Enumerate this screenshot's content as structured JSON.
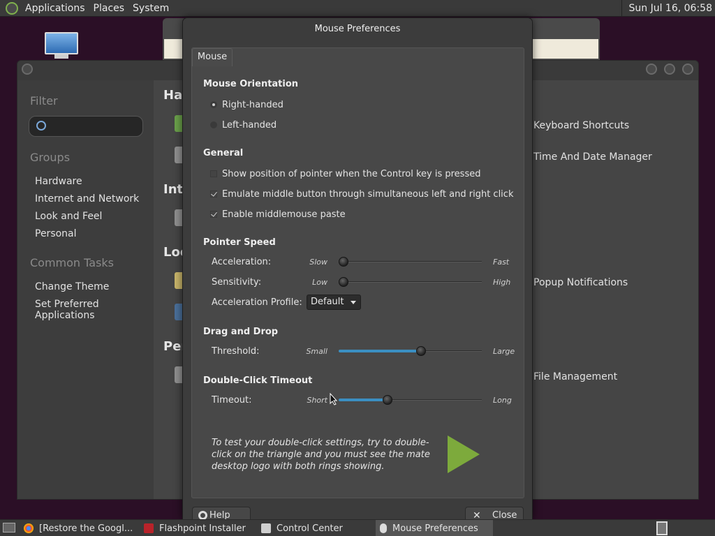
{
  "top_panel": {
    "menus": [
      "Applications",
      "Places",
      "System"
    ],
    "clock": "Sun Jul 16, 06:58"
  },
  "control_center": {
    "sidebar": {
      "filter_heading": "Filter",
      "groups_heading": "Groups",
      "groups": [
        "Hardware",
        "Internet and Network",
        "Look and Feel",
        "Personal"
      ],
      "tasks_heading": "Common Tasks",
      "tasks": [
        "Change Theme",
        "Set Preferred Applications"
      ]
    },
    "main": {
      "group_headings": [
        "Har",
        "Inte",
        "Loo",
        "Per"
      ],
      "items": [
        "Keyboard Shortcuts",
        "Time And Date Manager",
        "Popup Notifications",
        "File Management"
      ]
    }
  },
  "dialog": {
    "title": "Mouse Preferences",
    "tab": "Mouse",
    "orientation": {
      "heading": "Mouse Orientation",
      "options": [
        {
          "label": "Right-handed",
          "selected": true
        },
        {
          "label": "Left-handed",
          "selected": false
        }
      ]
    },
    "general": {
      "heading": "General",
      "options": [
        {
          "label": "Show position of pointer when the Control key is pressed",
          "checked": false
        },
        {
          "label": "Emulate middle button through simultaneous left and right click",
          "checked": true
        },
        {
          "label": "Enable middlemouse paste",
          "checked": true
        }
      ]
    },
    "pointer_speed": {
      "heading": "Pointer Speed",
      "acceleration": {
        "label": "Acceleration:",
        "min": "Slow",
        "max": "Fast",
        "value_fraction": 0.0
      },
      "sensitivity": {
        "label": "Sensitivity:",
        "min": "Low",
        "max": "High",
        "value_fraction": 0.0
      },
      "profile": {
        "label": "Acceleration Profile:",
        "value": "Default"
      }
    },
    "drag_drop": {
      "heading": "Drag and Drop",
      "threshold": {
        "label": "Threshold:",
        "min": "Small",
        "max": "Large",
        "value_fraction": 0.58
      }
    },
    "double_click": {
      "heading": "Double-Click Timeout",
      "timeout": {
        "label": "Timeout:",
        "min": "Short",
        "max": "Long",
        "value_fraction": 0.33
      }
    },
    "test_text": "To test your double-click settings, try to double-click on the triangle and you must see the mate desktop logo with both rings showing.",
    "buttons": {
      "help": "Help",
      "close": "Close"
    }
  },
  "taskbar": {
    "tasks": [
      "[Restore the Googl...",
      "Flashpoint Installer",
      "Control Center",
      "Mouse Preferences"
    ]
  },
  "colors": {
    "accent": "#3b8fc2",
    "triangle": "#7daa3c"
  }
}
